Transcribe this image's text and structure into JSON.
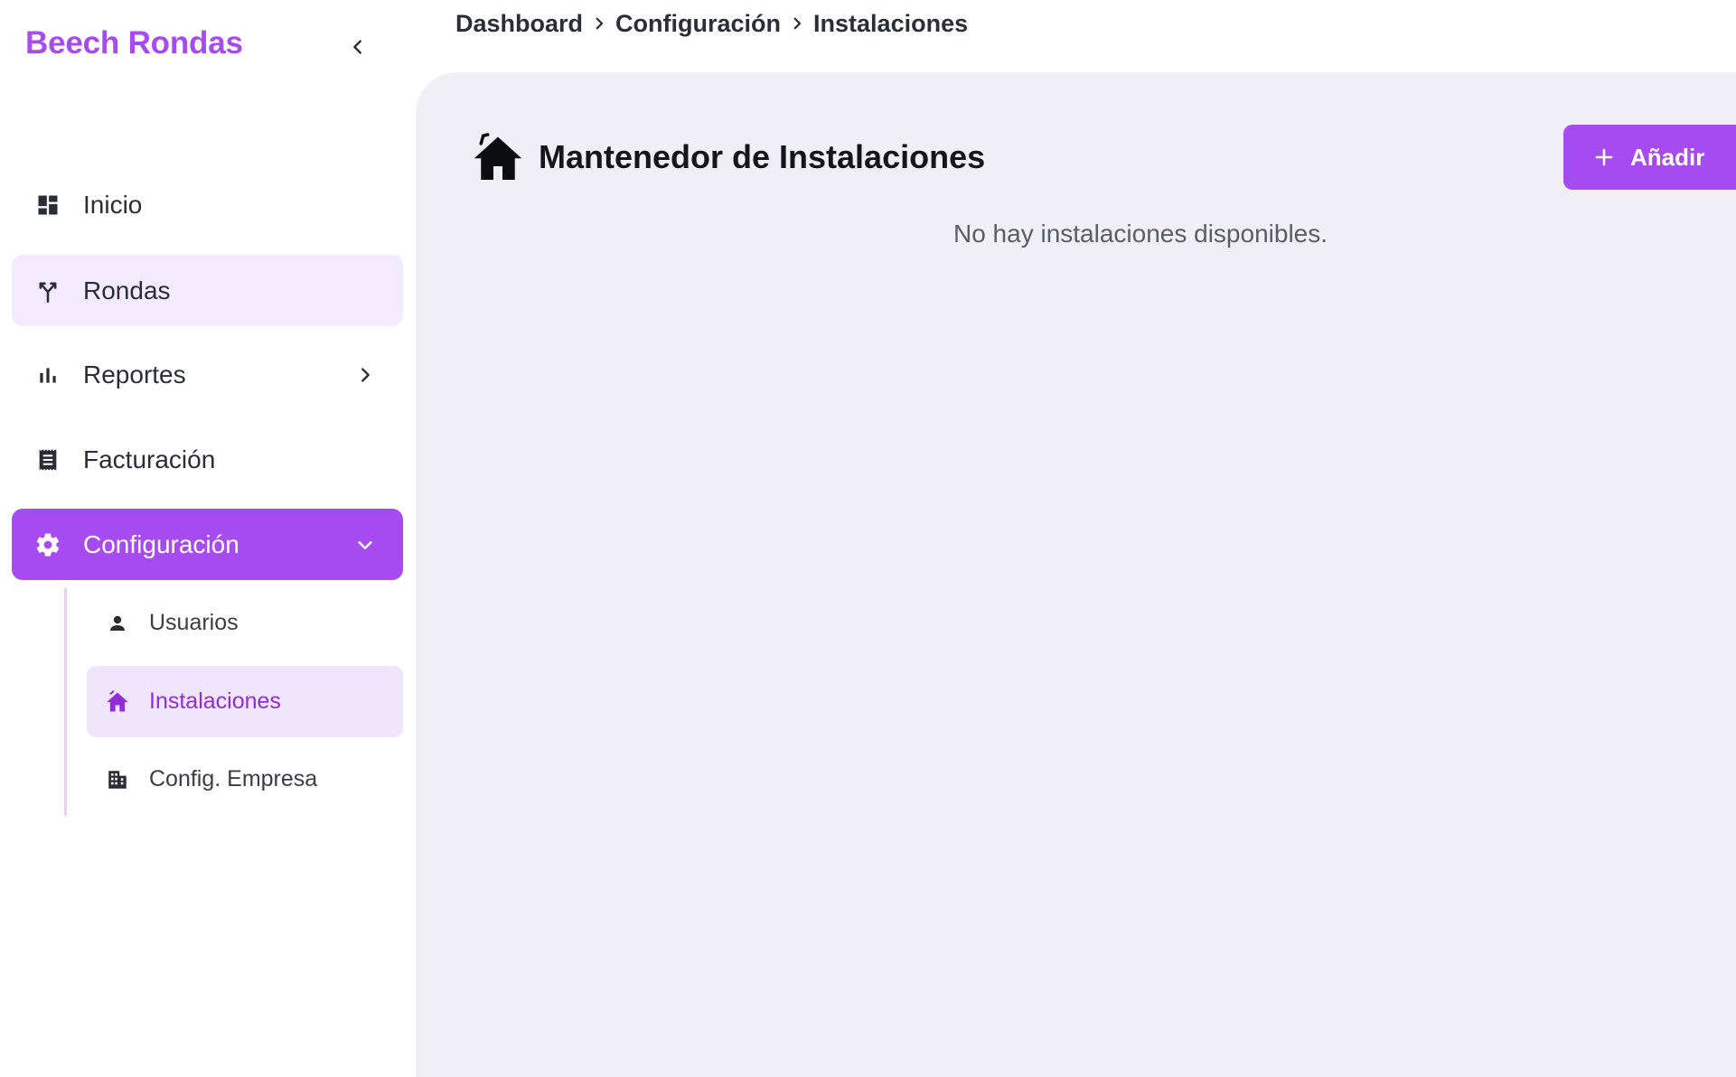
{
  "app": {
    "brand": "Beech Rondas"
  },
  "colors": {
    "accent": "#a64bf0",
    "accent_light": "#f3eafd",
    "panel_bg": "#f0eff5"
  },
  "breadcrumb": [
    {
      "label": "Dashboard"
    },
    {
      "label": "Configuración"
    },
    {
      "label": "Instalaciones"
    }
  ],
  "sidebar": {
    "items": [
      {
        "label": "Inicio",
        "icon": "dashboard-icon"
      },
      {
        "label": "Rondas",
        "icon": "route-icon"
      },
      {
        "label": "Reportes",
        "icon": "bar-chart-icon"
      },
      {
        "label": "Facturación",
        "icon": "receipt-icon"
      },
      {
        "label": "Configuración",
        "icon": "gear-icon"
      }
    ],
    "subitems": [
      {
        "label": "Usuarios",
        "icon": "user-icon"
      },
      {
        "label": "Instalaciones",
        "icon": "house-icon"
      },
      {
        "label": "Config. Empresa",
        "icon": "building-icon"
      }
    ]
  },
  "main": {
    "title": "Mantenedor de Instalaciones",
    "add_label": "Añadir",
    "empty_message": "No hay instalaciones disponibles."
  }
}
